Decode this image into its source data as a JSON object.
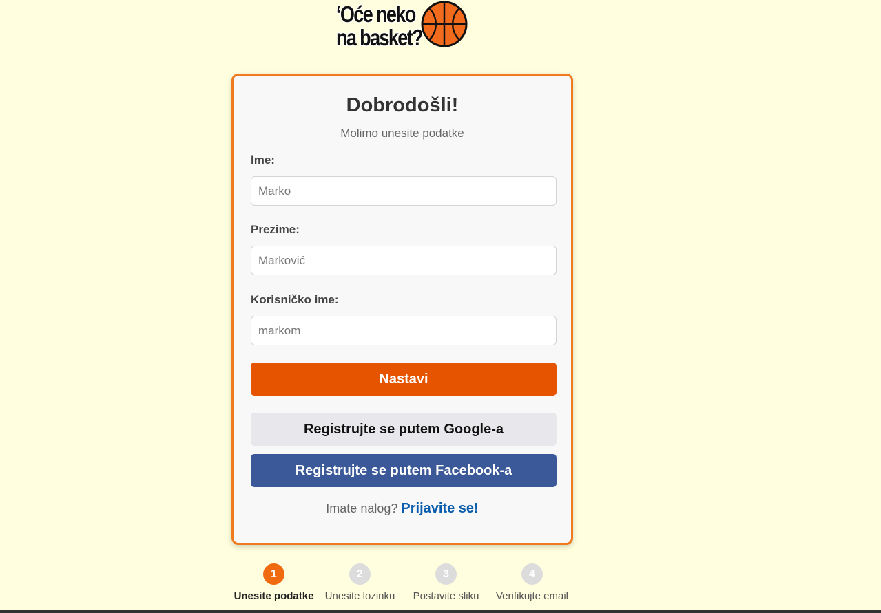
{
  "logo": {
    "line1": "‘Oće neko",
    "line2": "na basket?"
  },
  "card": {
    "title": "Dobrodošli!",
    "subtitle": "Molimo unesite podatke",
    "fields": [
      {
        "label": "Ime:",
        "placeholder": "Marko"
      },
      {
        "label": "Prezime:",
        "placeholder": "Marković"
      },
      {
        "label": "Korisničko ime:",
        "placeholder": "markom"
      }
    ],
    "continue_label": "Nastavi",
    "google_label": "Registrujte se putem Google-a",
    "facebook_label": "Registrujte se putem Facebook-a",
    "login_prompt": "Imate nalog?",
    "login_link": "Prijavite se!"
  },
  "steps": [
    {
      "number": "1",
      "label": "Unesite podatke",
      "active": true
    },
    {
      "number": "2",
      "label": "Unesite lozinku",
      "active": false
    },
    {
      "number": "3",
      "label": "Postavite sliku",
      "active": false
    },
    {
      "number": "4",
      "label": "Verifikujte email",
      "active": false
    }
  ],
  "colors": {
    "background": "#ffffdf",
    "accent": "#e65400",
    "card_border": "#f07a20",
    "facebook": "#3b5998",
    "google": "#e8e8ec",
    "link": "#0a5cad"
  },
  "icons": {
    "logo_ball": "basketball-icon"
  }
}
